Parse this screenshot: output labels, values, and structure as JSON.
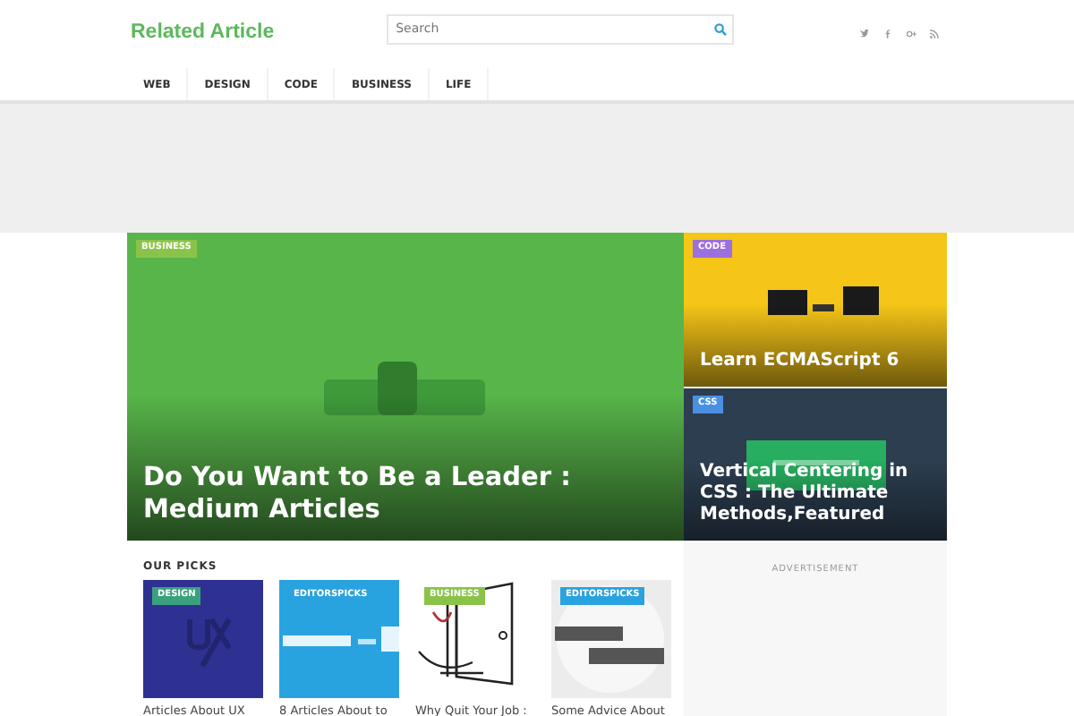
{
  "logo": "Related Article",
  "search": {
    "placeholder": "Search"
  },
  "social": [
    {
      "kind": "twitter"
    },
    {
      "kind": "facebook"
    },
    {
      "kind": "google"
    },
    {
      "kind": "rss"
    }
  ],
  "nav": [
    "WEB",
    "DESIGN",
    "CODE",
    "BUSINESS",
    "LIFE"
  ],
  "featured": [
    {
      "category": "BUSINESS",
      "color": "#8bc34a",
      "title": "Do You Want to Be a Leader : Medium Articles"
    },
    {
      "category": "CODE",
      "color": "#9b6fe0",
      "title": "Learn ECMAScript 6"
    },
    {
      "category": "CSS",
      "color": "#4a90e2",
      "title": "Vertical Centering in CSS : The Ultimate Methods,Featured"
    }
  ],
  "picks": {
    "heading": "OUR PICKS",
    "items": [
      {
        "category": "DESIGN",
        "color": "#3aa17e",
        "title": "Articles About UX"
      },
      {
        "category": "EDITORSPICKS",
        "color": "#29a3e0",
        "title": "8 Articles About to"
      },
      {
        "category": "BUSINESS",
        "color": "#8bc34a",
        "title": "Why Quit Your Job :"
      },
      {
        "category": "EDITORSPICKS",
        "color": "#29a3e0",
        "title": "Some Advice About"
      }
    ]
  },
  "ad": "ADVERTISEMENT"
}
